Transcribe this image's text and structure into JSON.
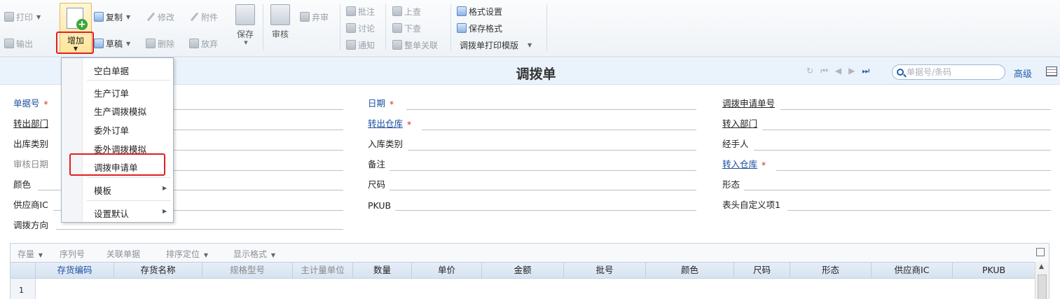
{
  "ribbon": {
    "print": "打印",
    "export": "输出",
    "add": "增加",
    "copy": "复制",
    "draft": "草稿",
    "modify": "修改",
    "delete": "删除",
    "attach": "附件",
    "abandon": "放弃",
    "save": "保存",
    "audit": "审核",
    "discard_audit": "弃审",
    "annotate": "批注",
    "discuss": "讨论",
    "notify": "通知",
    "lookup_up": "上查",
    "lookup_down": "下查",
    "whole_link": "整单关联",
    "format_settings": "格式设置",
    "save_format": "保存格式",
    "print_template": "调拨单打印模版"
  },
  "titlebar": {
    "title": "调拨单",
    "search_placeholder": "单据号/条码",
    "advanced": "高级"
  },
  "form": {
    "doc_no": "单据号",
    "out_dept": "转出部门",
    "out_type": "出库类别",
    "audit_date": "审核日期",
    "color": "颜色",
    "supplier_ic": "供应商IC",
    "transfer_dir": "调拨方向",
    "date": "日期",
    "out_wh": "转出仓库",
    "in_type": "入库类别",
    "remark": "备注",
    "size": "尺码",
    "pkub": "PKUB",
    "req_no": "调拨申请单号",
    "in_dept": "转入部门",
    "handler": "经手人",
    "in_wh": "转入仓库",
    "shape": "形态",
    "header_custom1": "表头自定义项1",
    "required_mark": "*"
  },
  "menu": {
    "items": [
      "空白单据",
      "生产订单",
      "生产调拨模拟",
      "委外订单",
      "委外调拨模拟",
      "调拨申请单",
      "模板",
      "设置默认"
    ]
  },
  "grid": {
    "toolbar": [
      "存量",
      "序列号",
      "关联单据",
      "排序定位",
      "显示格式"
    ],
    "columns": [
      "存货编码",
      "存货名称",
      "规格型号",
      "主计量单位",
      "数量",
      "单价",
      "金额",
      "批号",
      "颜色",
      "尺码",
      "形态",
      "供应商IC",
      "PKUB"
    ],
    "rows": [
      {
        "num": "1"
      }
    ]
  }
}
